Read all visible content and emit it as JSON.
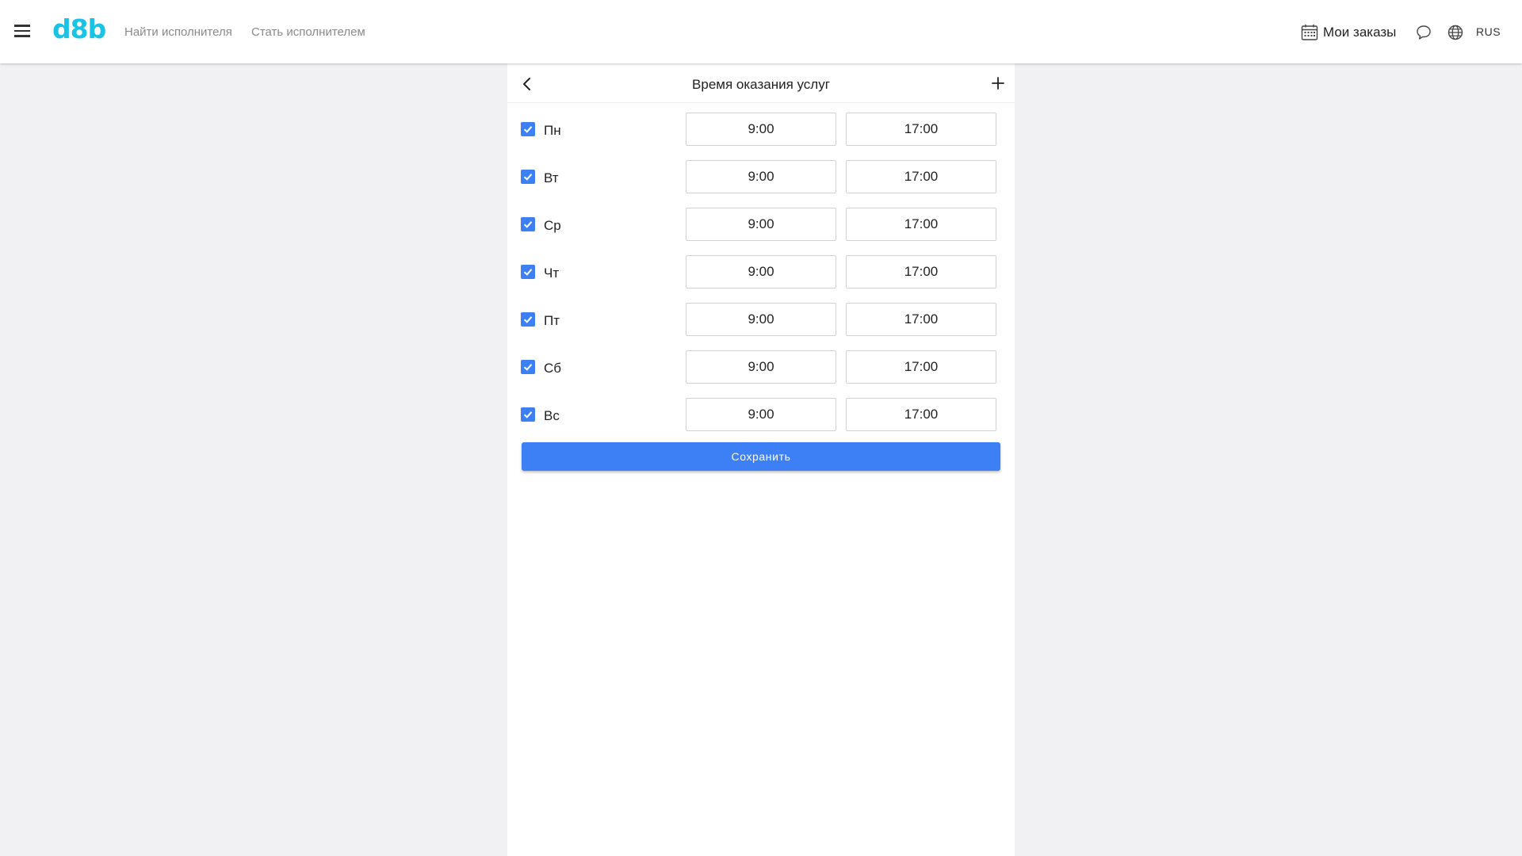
{
  "header": {
    "logo": "d8b",
    "nav": {
      "find_performer": "Найти исполнителя",
      "become_performer": "Стать исполнителем"
    },
    "orders_label": "Мои заказы",
    "language": "RUS",
    "icons": {
      "menu": "hamburger-icon",
      "orders": "calendar-icon",
      "chat": "chat-bubble-icon",
      "language": "globe-icon"
    }
  },
  "panel": {
    "title": "Время оказания услуг",
    "icons": {
      "back": "chevron-left-icon",
      "add": "plus-icon"
    },
    "days": [
      {
        "label": "Пн",
        "checked": true,
        "start": "9:00",
        "end": "17:00"
      },
      {
        "label": "Вт",
        "checked": true,
        "start": "9:00",
        "end": "17:00"
      },
      {
        "label": "Ср",
        "checked": true,
        "start": "9:00",
        "end": "17:00"
      },
      {
        "label": "Чт",
        "checked": true,
        "start": "9:00",
        "end": "17:00"
      },
      {
        "label": "Пт",
        "checked": true,
        "start": "9:00",
        "end": "17:00"
      },
      {
        "label": "Сб",
        "checked": true,
        "start": "9:00",
        "end": "17:00"
      },
      {
        "label": "Вс",
        "checked": true,
        "start": "9:00",
        "end": "17:00"
      }
    ],
    "save_label": "Сохранить"
  },
  "colors": {
    "accent": "#3d7ff5",
    "logo": "#18c3e6",
    "background": "#f1f1f3"
  }
}
